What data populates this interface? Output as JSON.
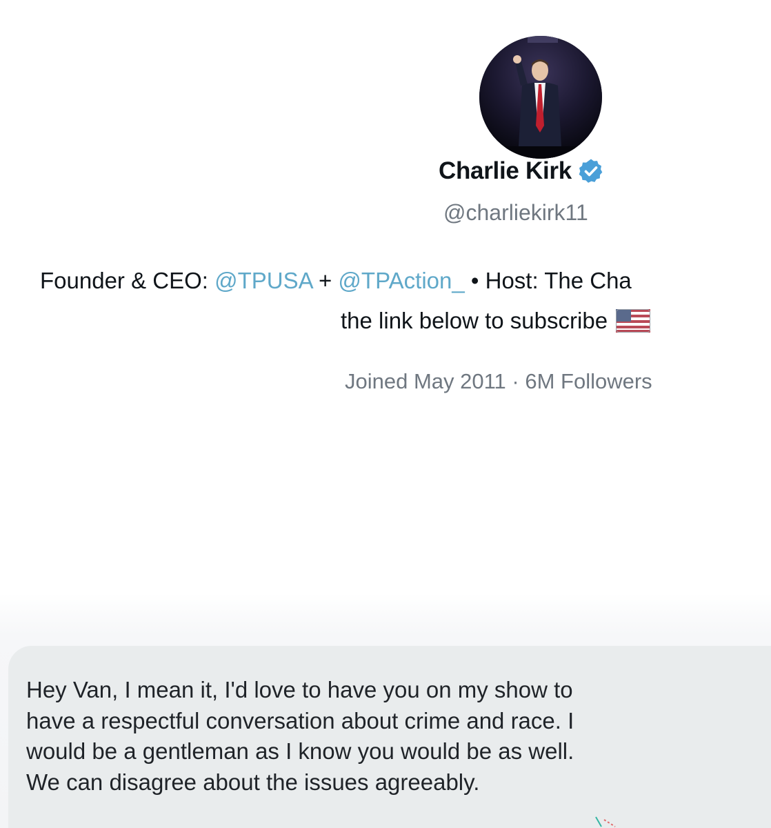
{
  "profile": {
    "avatar_icon": "profile-photo",
    "display_name": "Charlie Kirk",
    "verified_icon": "verified-badge-icon",
    "handle": "@charliekirk11",
    "bio": {
      "prefix": "Founder & CEO: ",
      "mention1": "@TPUSA",
      "joiner": " + ",
      "mention2": "@TPAction_",
      "suffix": " • Host: The Cha",
      "line2": "the link below to subscribe",
      "flag_icon": "us-flag-icon"
    },
    "meta": "Joined May 2011 · 6M Followers"
  },
  "message": {
    "lines": [
      "Hey Van, I mean it, I'd love to have you on my show to",
      "have a respectful conversation about crime and race. I",
      "would be a gentleman as I know you would be as well.",
      "We can disagree about the issues agreeably."
    ]
  },
  "colors": {
    "link": "#5fa8c9",
    "verified": "#4a9fd8",
    "muted": "#6f7780",
    "bubble": "#e9eced"
  }
}
